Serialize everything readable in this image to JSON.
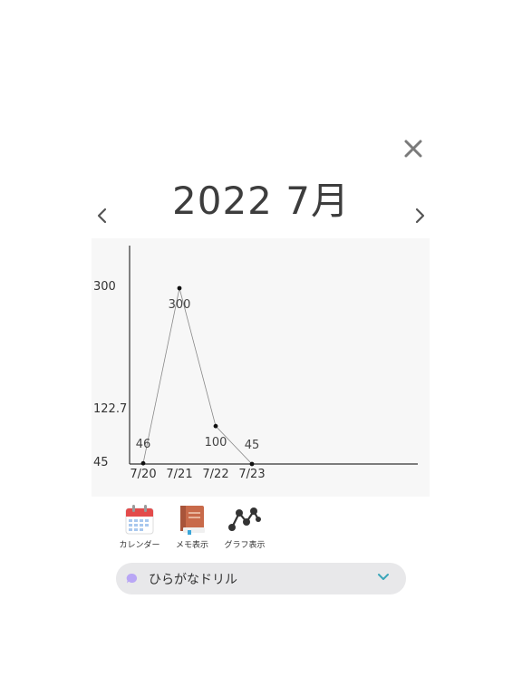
{
  "header": {
    "title": "2022 7月"
  },
  "icons": {
    "close": "close-icon",
    "prev": "chevron-left-icon",
    "next": "chevron-right-icon"
  },
  "chart_data": {
    "type": "line",
    "categories": [
      "7/20",
      "7/21",
      "7/22",
      "7/23"
    ],
    "series": [
      {
        "values": [
          46,
          300,
          100,
          45
        ]
      }
    ],
    "y_tick_labels": [
      "300",
      "122.7",
      "45"
    ],
    "ylim": [
      45,
      300
    ],
    "data_labels": [
      "46",
      "300",
      "100",
      "45"
    ],
    "title": "",
    "xlabel": "",
    "ylabel": "",
    "grid": false,
    "line_color": "#888888",
    "point_color": "#111111"
  },
  "toolbar": {
    "calendar_label": "カレンダー",
    "memo_label": "メモ表示",
    "graph_label": "グラフ表示"
  },
  "drill": {
    "label": "ひらがなドリル",
    "dot_color": "#b9a6f5",
    "chevron_color": "#3aa6b9"
  },
  "colors": {
    "chart_background": "#f7f7f7",
    "pill_background": "#e8e8ea",
    "close_icon": "#7a7a7a"
  }
}
